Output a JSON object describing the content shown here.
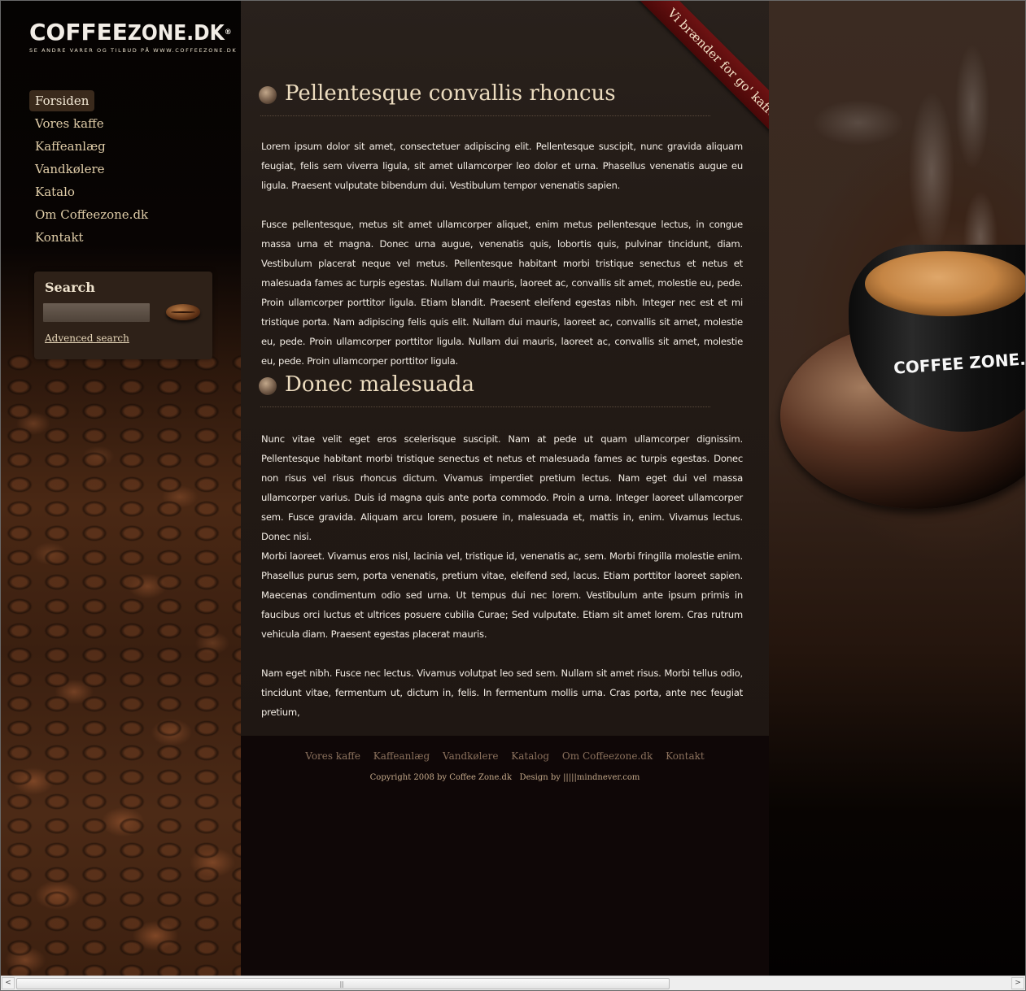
{
  "logo": {
    "text_coffee": "COFFEE",
    "text_zone": "ZONE.DK",
    "trademark": "®",
    "tagline": "SE ANDRE VARER OG TILBUD PÅ WWW.COFFEEZONE.DK"
  },
  "nav": {
    "items": [
      "Forsiden",
      "Vores kaffe",
      "Kaffeanlæg",
      "Vandkølere",
      "Katalo",
      "Om Coffeezone.dk",
      "Kontakt"
    ],
    "active_index": 0
  },
  "search": {
    "title": "Search",
    "input_value": "",
    "advanced_link": "Advenced search"
  },
  "ribbon": {
    "text": "Vi brænder for go' kaffe"
  },
  "sections": [
    {
      "heading": "Pellentesque convallis rhoncus",
      "paragraphs": [
        "Lorem ipsum dolor sit amet, consectetuer adipiscing elit. Pellentesque suscipit, nunc gravida aliquam feugiat, felis sem viverra ligula, sit amet ullamcorper leo dolor et urna. Phasellus venenatis augue eu ligula. Praesent vulputate bibendum dui. Vestibulum tempor venenatis sapien.",
        "Fusce pellentesque, metus sit amet ullamcorper aliquet, enim metus pellentesque lectus, in congue massa urna et magna. Donec urna augue, venenatis quis, lobortis quis, pulvinar tincidunt, diam. Vestibulum placerat neque vel metus. Pellentesque habitant morbi tristique senectus et netus et malesuada fames ac turpis egestas. Nullam dui mauris, laoreet ac, convallis sit amet, molestie eu, pede. Proin ullamcorper porttitor ligula. Etiam blandit. Praesent eleifend egestas nibh. Integer nec est et mi tristique porta. Nam adipiscing felis quis elit.  Nullam dui mauris, laoreet ac, convallis sit amet, molestie eu, pede. Proin ullamcorper porttitor ligula. Nullam dui mauris, laoreet ac, convallis sit amet, molestie eu, pede. Proin ullamcorper porttitor ligula."
      ]
    },
    {
      "heading": "Donec malesuada",
      "paragraphs": [
        "Nunc vitae velit eget eros scelerisque suscipit. Nam at pede ut quam ullamcorper dignissim. Pellentesque habitant morbi tristique senectus et netus et malesuada fames ac turpis egestas. Donec non risus vel risus rhoncus dictum. Vivamus imperdiet pretium lectus. Nam eget dui vel massa ullamcorper varius. Duis id magna quis ante porta commodo. Proin a urna. Integer laoreet ullamcorper sem. Fusce gravida. Aliquam arcu lorem, posuere in, malesuada et, mattis in, enim. Vivamus lectus. Donec nisi.",
        "Morbi laoreet. Vivamus eros nisl, lacinia vel, tristique id, venenatis ac, sem. Morbi fringilla molestie enim. Phasellus purus sem, porta venenatis, pretium vitae, eleifend sed, lacus. Etiam porttitor laoreet sapien. Maecenas condimentum odio sed urna. Ut tempus dui nec lorem. Vestibulum ante ipsum primis in faucibus orci luctus et ultrices posuere cubilia Curae; Sed vulputate. Etiam sit amet lorem. Cras rutrum vehicula diam. Praesent egestas placerat mauris.",
        "Nam eget nibh. Fusce nec lectus. Vivamus volutpat leo sed sem. Nullam sit amet risus. Morbi tellus odio, tincidunt vitae, fermentum ut, dictum in, felis. In fermentum mollis urna. Cras porta, ante nec feugiat pretium,"
      ]
    }
  ],
  "footer": {
    "links": [
      "Vores kaffe",
      "Kaffeanlæg",
      "Vandkølere",
      "Katalog",
      "Om Coffeezone.dk",
      "Kontakt"
    ],
    "copyright": "Copyright 2008 by Coffee Zone.dk   Design by |||||mindnever.com"
  },
  "cup_logo": "COFFEE ZONE.DK",
  "scrollbar": {
    "left_arrow": "<",
    "right_arrow": ">",
    "grip": "|||"
  },
  "colors": {
    "nav_text": "#e0cda8",
    "heading": "#ecdcbf",
    "body_text": "#f2ece4",
    "ribbon": "#6e1313",
    "footer_link": "#8a705c",
    "footer_copy": "#c4a98a"
  }
}
